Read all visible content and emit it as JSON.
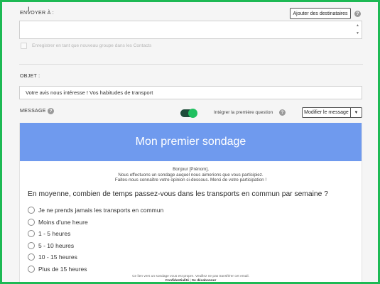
{
  "recipients": {
    "label": "ENVOYER À :",
    "add_button": "Ajouter des destinataires",
    "help_icon": "?",
    "save_group_label": "Enregistrer en tant que nouveau groupe dans les Contacts"
  },
  "subject": {
    "label": "OBJET :",
    "value": "Votre avis nous intéresse ! Vos habitudes de transport"
  },
  "message": {
    "label": "MESSAGE :",
    "help_icon": "?",
    "toggle_on": true,
    "toggle_label": "Intégrer la première question",
    "toggle_help_icon": "?",
    "edit_button": "Modifier le message",
    "dropdown_arrow": "▼"
  },
  "email": {
    "banner_title": "Mon premier sondage",
    "banner_color": "#6f9aee",
    "greeting": "Bonjour [Prénom],",
    "intro_line1": "Nous effectuons un sondage auquel nous aimerions que vous participiez.",
    "intro_line2": "Faites-nous connaître votre opinion ci-dessous. Merci de votre participation !",
    "question": "En moyenne, combien de temps passez-vous dans les transports en commun par semaine ?",
    "options": [
      "Je ne prends jamais les transports en commun",
      "Moins d'une heure",
      "1 - 5 heures",
      "5 - 10 heures",
      "10 - 15 heures",
      "Plus de 15 heures"
    ],
    "footer_note": "Ce lien vers un sondage vous est propre. Veuillez ne pas transférer cet email.",
    "footer_link1": "Confidentialité",
    "footer_sep": "|",
    "footer_link2": "Se désabonner"
  },
  "colors": {
    "frame": "#1db954",
    "toggle": "#20c060"
  }
}
